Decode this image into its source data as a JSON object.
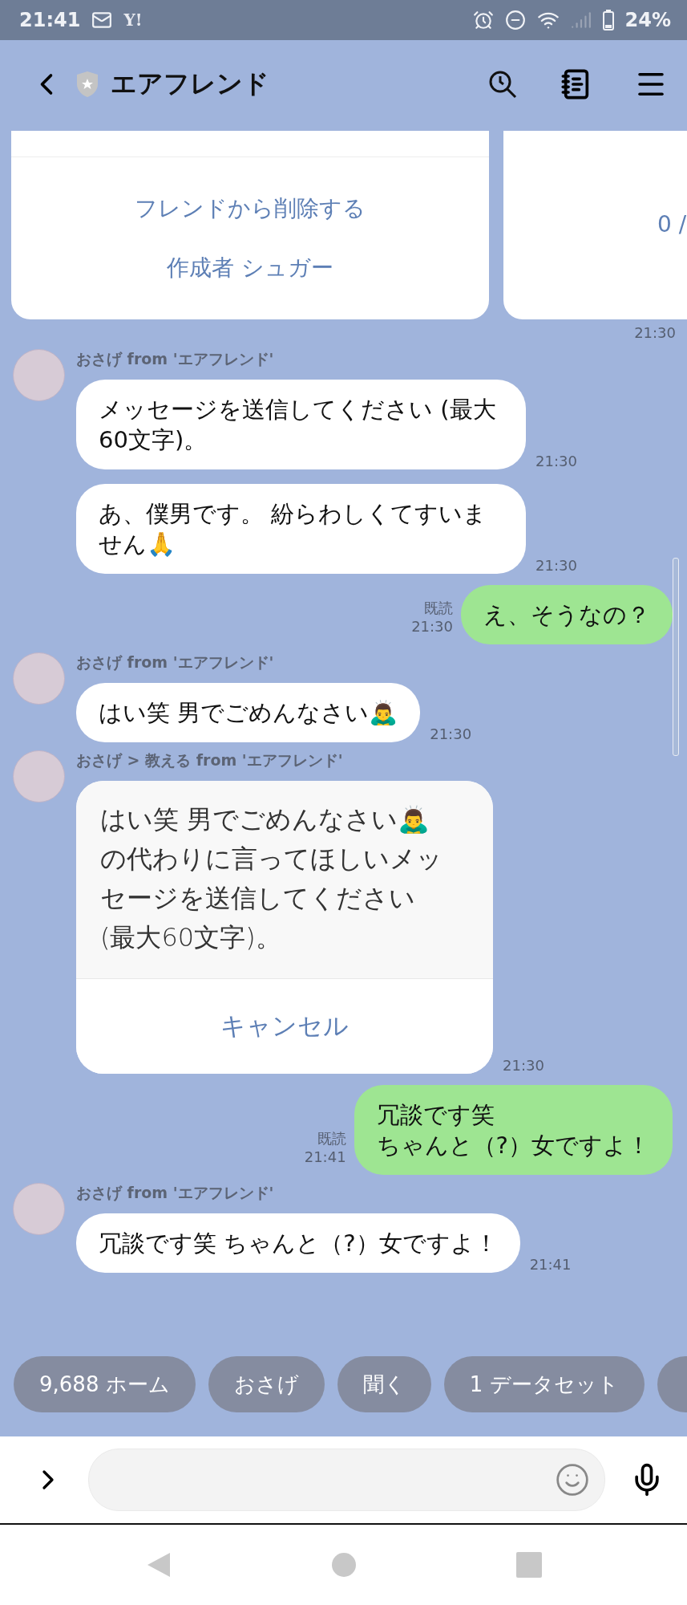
{
  "status_bar": {
    "time": "21:41",
    "notification": "Y!",
    "battery": "24%"
  },
  "header": {
    "title": "エアフレンド"
  },
  "cards": {
    "actions": [
      "フレンドから削除する",
      "作成者 シュガー"
    ],
    "side_text": "0 /",
    "time": "21:30"
  },
  "messages": [
    {
      "kind": "incoming",
      "sender": "おさげ from 'エアフレンド'",
      "bubbles": [
        {
          "text": "メッセージを送信してください (最大60文字)。",
          "time": "21:30"
        },
        {
          "text": "あ、僕男です。 紛らわしくてすいません🙏",
          "time": "21:30"
        }
      ]
    },
    {
      "kind": "outgoing",
      "read": "既読",
      "time": "21:30",
      "lines": [
        "え、そうなの？"
      ]
    },
    {
      "kind": "incoming",
      "sender": "おさげ from 'エアフレンド'",
      "bubbles": [
        {
          "text": "はい笑 男でごめんなさい🙇‍♂️",
          "time": "21:30"
        }
      ]
    },
    {
      "kind": "prompt",
      "sender": "おさげ > 教える from 'エアフレンド'",
      "text": "はい笑 男でごめんなさい🙇‍♂️ の代わりに言ってほしいメッセージを送信してください (最大60文字)。",
      "action": "キャンセル",
      "time": "21:30"
    },
    {
      "kind": "outgoing",
      "read": "既読",
      "time": "21:41",
      "lines": [
        "冗談です笑",
        "ちゃんと（?）女ですよ！"
      ]
    },
    {
      "kind": "incoming",
      "sender": "おさげ from 'エアフレンド'",
      "bubbles": [
        {
          "text": "冗談です笑 ちゃんと（?）女ですよ！",
          "time": "21:41"
        }
      ]
    }
  ],
  "quick_replies": [
    "9,688 ホーム",
    "おさげ",
    "聞く",
    "1 データセット"
  ]
}
